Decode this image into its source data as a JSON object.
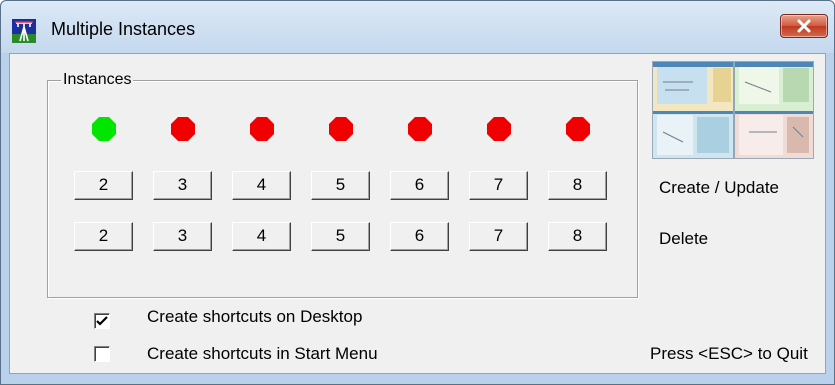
{
  "window": {
    "title": "Multiple Instances",
    "app_icon": "antenna-tower-icon",
    "close_icon": "close-x-icon"
  },
  "group": {
    "label": "Instances",
    "indicators": [
      {
        "instance": "2",
        "status": "active",
        "color": "#00e600"
      },
      {
        "instance": "3",
        "status": "inactive",
        "color": "#f00000"
      },
      {
        "instance": "4",
        "status": "inactive",
        "color": "#f00000"
      },
      {
        "instance": "5",
        "status": "inactive",
        "color": "#f00000"
      },
      {
        "instance": "6",
        "status": "inactive",
        "color": "#f00000"
      },
      {
        "instance": "7",
        "status": "inactive",
        "color": "#f00000"
      },
      {
        "instance": "8",
        "status": "inactive",
        "color": "#f00000"
      }
    ],
    "create_buttons": [
      "2",
      "3",
      "4",
      "5",
      "6",
      "7",
      "8"
    ],
    "delete_buttons": [
      "2",
      "3",
      "4",
      "5",
      "6",
      "7",
      "8"
    ]
  },
  "labels": {
    "create_update": "Create / Update",
    "delete": "Delete",
    "quit": "Press <ESC> to Quit"
  },
  "preview": {
    "icon": "multi-window-preview-thumbnail"
  },
  "options": [
    {
      "label": "Create shortcuts on Desktop",
      "checked": true
    },
    {
      "label": "Create shortcuts in Start Menu",
      "checked": false
    }
  ]
}
